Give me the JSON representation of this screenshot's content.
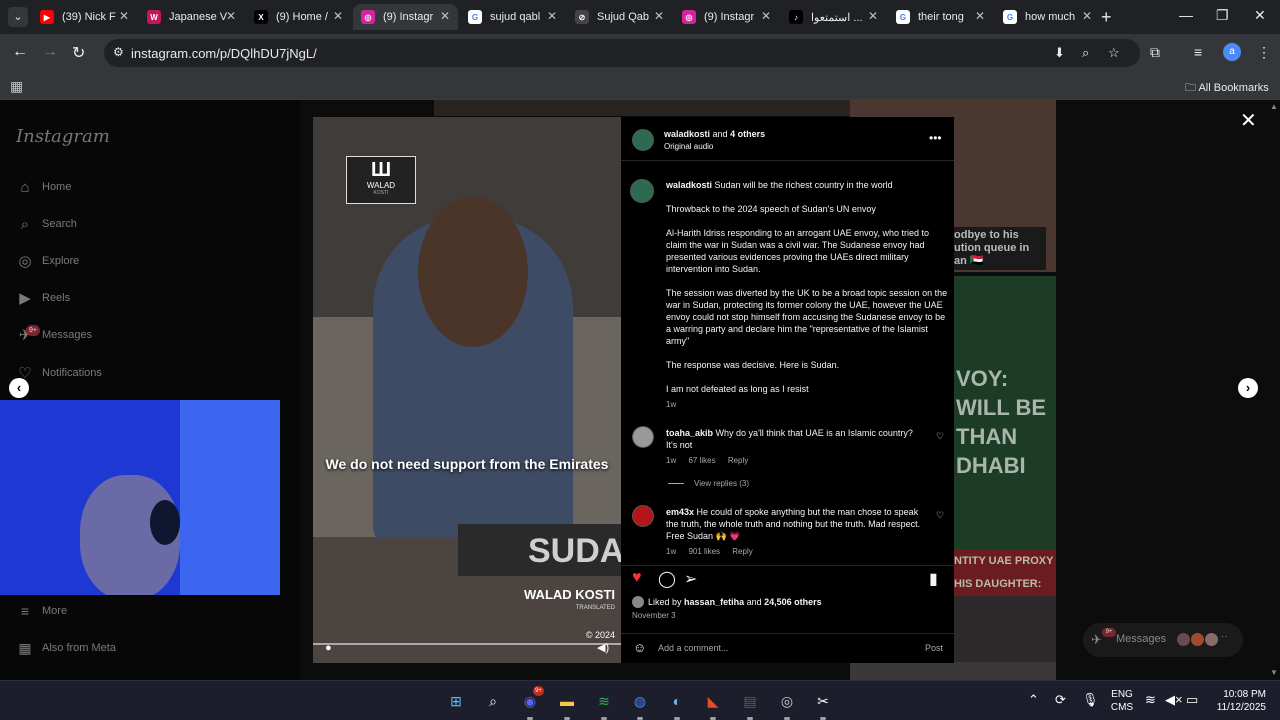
{
  "browser": {
    "tabs": [
      {
        "label": "(39) Nick F",
        "fav_color": "#ff0000",
        "fav_glyph": "▶"
      },
      {
        "label": "Japanese V",
        "fav_color": "#c2185b",
        "fav_glyph": "W"
      },
      {
        "label": "(9) Home /",
        "fav_color": "#000000",
        "fav_glyph": "X"
      },
      {
        "label": "(9) Instagr",
        "fav_color": "#d6249f",
        "fav_glyph": "◎"
      },
      {
        "label": "sujud qabl",
        "fav_color": "#ffffff",
        "fav_glyph": "G"
      },
      {
        "label": "Sujud Qab",
        "fav_color": "#444444",
        "fav_glyph": "⊘"
      },
      {
        "label": "(9) Instagr",
        "fav_color": "#d6249f",
        "fav_glyph": "◎"
      },
      {
        "label": "استمتعوا ...",
        "fav_color": "#000000",
        "fav_glyph": "♪"
      },
      {
        "label": "their tong",
        "fav_color": "#ffffff",
        "fav_glyph": "G"
      },
      {
        "label": "how much",
        "fav_color": "#ffffff",
        "fav_glyph": "G"
      }
    ],
    "active_tab_index": 3,
    "url": "instagram.com/p/DQlhDU7jNgL/",
    "profile_initial": "a",
    "all_bookmarks": "All Bookmarks"
  },
  "instagram": {
    "logo": "Instagram",
    "nav": [
      {
        "label": "Home",
        "icon": "home-icon",
        "glyph": "⌂"
      },
      {
        "label": "Search",
        "icon": "search-icon",
        "glyph": "⌕"
      },
      {
        "label": "Explore",
        "icon": "compass-icon",
        "glyph": "◎"
      },
      {
        "label": "Reels",
        "icon": "reels-icon",
        "glyph": "▶"
      },
      {
        "label": "Messages",
        "icon": "messenger-icon",
        "glyph": "✈"
      },
      {
        "label": "Notifications",
        "icon": "heart-icon",
        "glyph": "♡"
      }
    ],
    "messages_badge": "9+",
    "more_label": "More",
    "also_from_meta": "Also from Meta",
    "messages_pill": {
      "label": "Messages",
      "badge": "9+"
    }
  },
  "background_posts": {
    "caption_top_right": "odbye to his ution queue in an 🇸🇩",
    "big_text": "VOY: WILL BE THAN DHABI",
    "caption_bottom": "NTITY UAE PROXY HIS DAUGHTER:"
  },
  "post": {
    "video": {
      "logo_main": "Ш",
      "logo_sub": "WALAD",
      "logo_sub2": "KOSTI",
      "caption": "We do not need support from the Emirates",
      "brand": "WALAD KOSTI",
      "brand_sub": "TRANSLATED",
      "year": "© 2024",
      "nameplate": "SUDA"
    },
    "header": {
      "author": "waladkosti",
      "co_authors": "4 others",
      "joiner": "and",
      "audio": "Original audio"
    },
    "caption": {
      "username": "waladkosti",
      "paragraphs": [
        "Sudan will be the richest country in the world",
        "Throwback to the 2024 speech of Sudan's UN envoy",
        "Al-Harith Idriss responding to an arrogant UAE envoy, who tried to claim the war in Sudan was a civil war. The Sudanese envoy had presented various evidences proving the UAEs direct military intervention into Sudan.",
        "The session was diverted by the UK to be a broad topic session on the war in Sudan, protecting its former colony the UAE, however the UAE envoy could not stop himself from accusing the Sudanese envoy to be a warring party and declare him the \"representative of the Islamist army\"",
        "The response was decisive. Here is Sudan.",
        "I am not defeated as long as I resist"
      ],
      "age": "1w"
    },
    "comments": [
      {
        "username": "toaha_akib",
        "text": "Why do ya'll think that UAE is an Islamic country? It's not",
        "age": "1w",
        "likes": "67 likes",
        "reply": "Reply",
        "view_replies": "View replies (3)"
      },
      {
        "username": "em43x",
        "text": "He could of spoke anything but the man chose to speak the truth, the whole truth and nothing but the truth. Mad respect. Free Sudan 🙌 💗",
        "age": "1w",
        "likes": "901 likes",
        "reply": "Reply"
      }
    ],
    "liked_by": {
      "prefix": "Liked by",
      "user": "hassan_fetiha",
      "joiner": "and",
      "count": "24,506 others"
    },
    "date": "November 3",
    "add_comment_placeholder": "Add a comment...",
    "post_button": "Post",
    "liked": true,
    "like_color": "#ff3040"
  },
  "taskbar": {
    "apps": [
      {
        "name": "windows-start-icon",
        "glyph": "⊞",
        "color": "#4cc2ff"
      },
      {
        "name": "search-icon",
        "glyph": "⌕",
        "color": "#ffffff"
      },
      {
        "name": "discord-icon",
        "glyph": "◉",
        "color": "#5865f2",
        "badge": "9+"
      },
      {
        "name": "file-explorer-icon",
        "glyph": "▬",
        "color": "#f2c94c"
      },
      {
        "name": "spotify-icon",
        "glyph": "≋",
        "color": "#1db954"
      },
      {
        "name": "chrome-icon",
        "glyph": "◍",
        "color": "#4285f4"
      },
      {
        "name": "steam-icon",
        "glyph": "◐",
        "color": "#66c0f4"
      },
      {
        "name": "app-icon",
        "glyph": "◣",
        "color": "#e44d26"
      },
      {
        "name": "stocks-app-icon",
        "glyph": "▤",
        "color": "#2e7d32"
      },
      {
        "name": "obs-icon",
        "glyph": "◎",
        "color": "#cccccc"
      },
      {
        "name": "snipping-tool-icon",
        "glyph": "✂",
        "color": "#ffffff"
      }
    ],
    "lang_top": "ENG",
    "lang_bottom": "CMS",
    "time": "10:08 PM",
    "date": "11/12/2025"
  }
}
